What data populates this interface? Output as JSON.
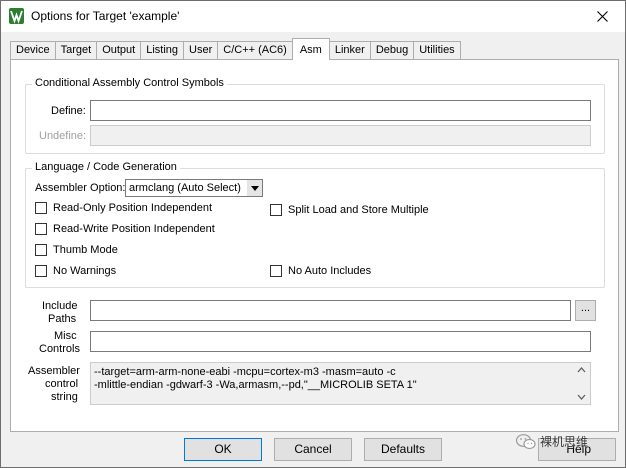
{
  "window": {
    "title": "Options for Target 'example'",
    "app_icon": "keil-uvision-icon",
    "close_glyph": "✕"
  },
  "tabs": [
    {
      "label": "Device"
    },
    {
      "label": "Target"
    },
    {
      "label": "Output"
    },
    {
      "label": "Listing"
    },
    {
      "label": "User"
    },
    {
      "label": "C/C++ (AC6)"
    },
    {
      "label": "Asm",
      "active": true
    },
    {
      "label": "Linker"
    },
    {
      "label": "Debug"
    },
    {
      "label": "Utilities"
    }
  ],
  "conditional": {
    "group_label": "Conditional Assembly Control Symbols",
    "define_label": "Define:",
    "define_value": "",
    "undefine_label": "Undefine:",
    "undefine_value": ""
  },
  "language": {
    "group_label": "Language / Code Generation",
    "assembler_option_label": "Assembler Option:",
    "assembler_option_value": "armclang (Auto Select)",
    "checkboxes": {
      "read_only": {
        "label": "Read-Only Position Independent",
        "checked": false
      },
      "read_write": {
        "label": "Read-Write Position Independent",
        "checked": false
      },
      "thumb_mode": {
        "label": "Thumb Mode",
        "checked": false
      },
      "no_warnings": {
        "label": "No Warnings",
        "checked": false
      },
      "split_load": {
        "label": "Split Load and Store Multiple",
        "checked": false
      },
      "no_auto_includes": {
        "label": "No Auto Includes",
        "checked": false
      }
    }
  },
  "include_paths": {
    "label_line1": "Include",
    "label_line2": "Paths",
    "value": "",
    "browse_label": "..."
  },
  "misc_controls": {
    "label_line1": "Misc",
    "label_line2": "Controls",
    "value": ""
  },
  "assembler_control": {
    "label_line1": "Assembler",
    "label_line2": "control",
    "label_line3": "string",
    "line1": "--target=arm-arm-none-eabi -mcpu=cortex-m3 -masm=auto -c",
    "line2": "-mlittle-endian -gdwarf-3 -Wa,armasm,--pd,\"__MICROLIB SETA 1\""
  },
  "buttons": {
    "ok": "OK",
    "cancel": "Cancel",
    "defaults": "Defaults",
    "help": "Help"
  },
  "watermark": {
    "text": "裸机思维",
    "icon": "wechat-icon"
  }
}
